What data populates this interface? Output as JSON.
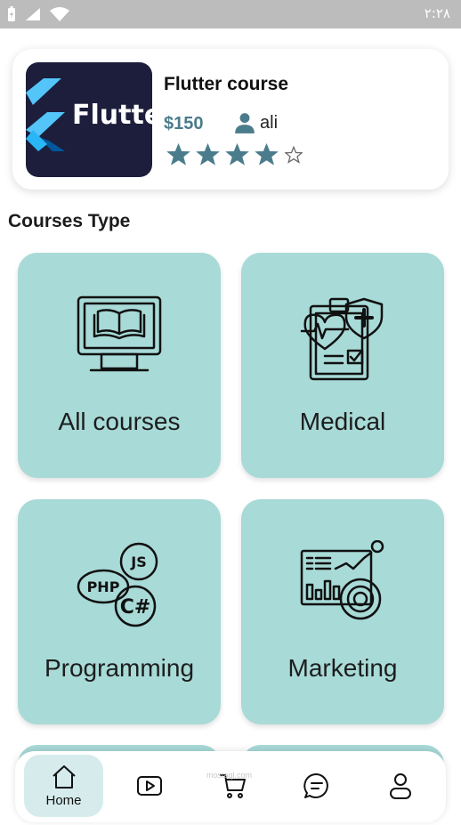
{
  "status_bar": {
    "time": "٢:٢٨"
  },
  "course": {
    "title": "Flutter course",
    "price": "$150",
    "instructor": "ali",
    "thumbnail_text": "Flutte",
    "rating": 4,
    "rating_max": 5
  },
  "section_title": "Courses Type",
  "categories": [
    {
      "label": "All courses",
      "icon": "monitor-book-icon"
    },
    {
      "label": "Medical",
      "icon": "medical-icon"
    },
    {
      "label": "Programming",
      "icon": "code-languages-icon"
    },
    {
      "label": "Marketing",
      "icon": "analytics-icon"
    }
  ],
  "bottom_nav": {
    "items": [
      {
        "label": "Home",
        "icon": "home-icon",
        "active": true
      },
      {
        "icon": "video-icon"
      },
      {
        "icon": "cart-icon"
      },
      {
        "icon": "chat-icon"
      },
      {
        "icon": "profile-icon"
      }
    ],
    "watermark": "mostaql.com"
  },
  "colors": {
    "accent": "#4b7c8c",
    "card_bg": "#a8dad7",
    "star": "#4b7c8c",
    "active_nav_bg": "#d6ecec"
  }
}
